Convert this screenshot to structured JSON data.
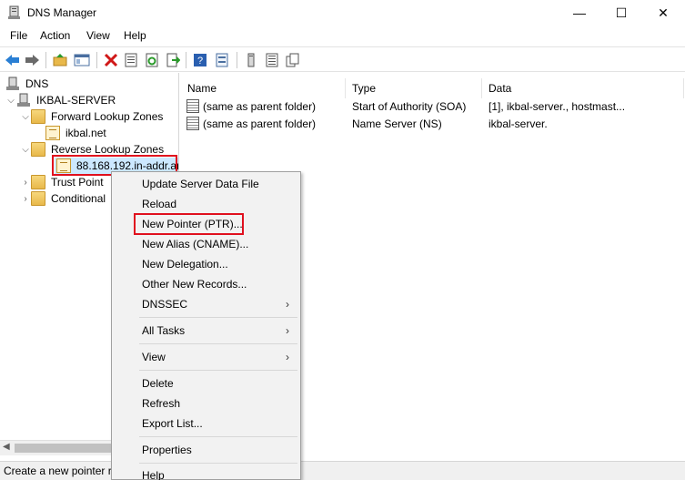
{
  "window": {
    "title": "DNS Manager",
    "min": "—",
    "max": "☐",
    "close": "✕"
  },
  "menu": [
    "File",
    "Action",
    "View",
    "Help"
  ],
  "tree": {
    "root": "DNS",
    "server": "IKBAL-SERVER",
    "forward": "Forward Lookup Zones",
    "forward_zone": "ikbal.net",
    "reverse": "Reverse Lookup Zones",
    "reverse_zone": "88.168.192.in-addr.ar",
    "trust": "Trust Point",
    "conditional": "Conditional"
  },
  "list": {
    "columns": [
      "Name",
      "Type",
      "Data"
    ],
    "rows": [
      {
        "name": "(same as parent folder)",
        "type": "Start of Authority (SOA)",
        "data": "[1], ikbal-server., hostmast..."
      },
      {
        "name": "(same as parent folder)",
        "type": "Name Server (NS)",
        "data": "ikbal-server."
      }
    ]
  },
  "context_menu": {
    "items": [
      "Update Server Data File",
      "Reload",
      "New Pointer (PTR)...",
      "New Alias (CNAME)...",
      "New Delegation...",
      "Other New Records...",
      "DNSSEC",
      "All Tasks",
      "View",
      "Delete",
      "Refresh",
      "Export List...",
      "Properties",
      "Help"
    ],
    "submenu_arrow": "›"
  },
  "status": "Create a new pointer re",
  "colors": {
    "highlight_box": "#e0101e",
    "selection": "#cce8ff"
  }
}
